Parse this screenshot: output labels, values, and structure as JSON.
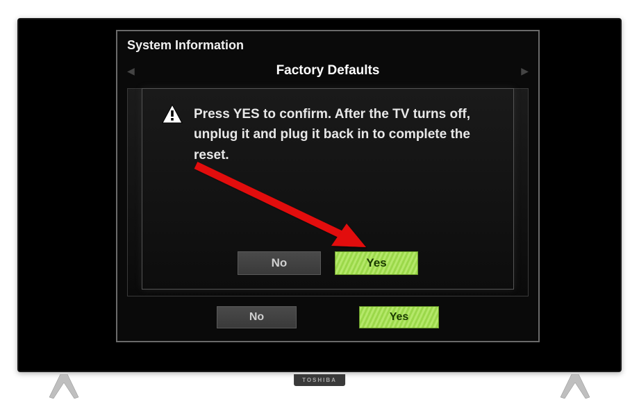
{
  "panel": {
    "title": "System Information",
    "subtitle": "Factory Defaults"
  },
  "dialog": {
    "message": "Press YES to confirm. After the TV turns off, unplug it and plug it back in to complete the reset.",
    "no_label": "No",
    "yes_label": "Yes"
  },
  "outer_buttons": {
    "no_label": "No",
    "yes_label": "Yes"
  },
  "brand": "TOSHIBA"
}
